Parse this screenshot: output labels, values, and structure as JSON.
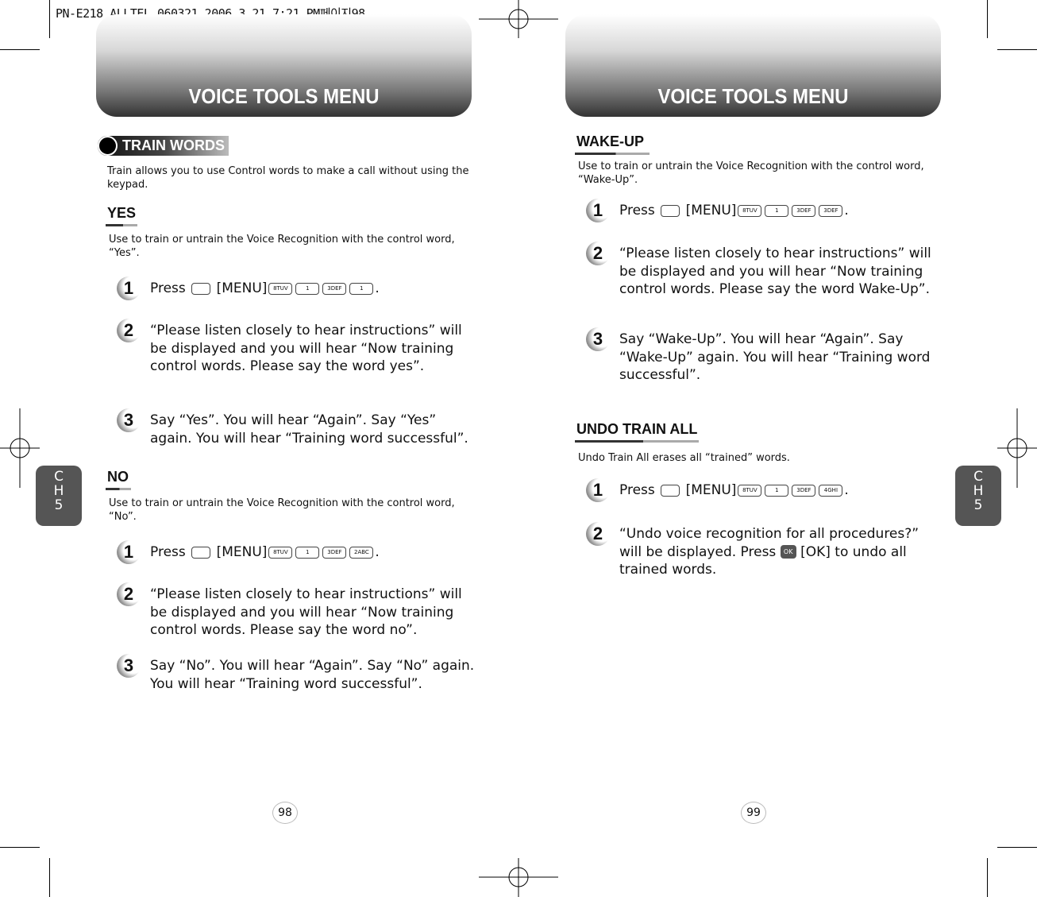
{
  "slug": "PN-E218_ALLTEL_060321  2006.3.21 7:21 PM페이지98",
  "left": {
    "banner": "VOICE TOOLS MENU",
    "section": "TRAIN WORDS",
    "intro": "Train allows you to use Control words to make a call without using the keypad.",
    "blocks": [
      {
        "title": "YES",
        "desc": "Use  to train or untrain the Voice Recognition with the control word, “Yes”.",
        "steps": [
          {
            "n": "1",
            "press": "Press",
            "menu": "[MENU]",
            "keys": [
              "8TUV",
              "1",
              "3DEF",
              "1"
            ]
          },
          {
            "n": "2",
            "text": "“Please listen closely to hear instructions” will be displayed and you will hear “Now training control words.  Please say the word yes”."
          },
          {
            "n": "3",
            "text": "Say “Yes”. You will hear “Again”. Say “Yes” again. You will hear “Training word successful”."
          }
        ]
      },
      {
        "title": "NO",
        "desc": "Use  to train or untrain the Voice Recognition with the control word, “No”.",
        "steps": [
          {
            "n": "1",
            "press": "Press",
            "menu": "[MENU]",
            "keys": [
              "8TUV",
              "1",
              "3DEF",
              "2ABC"
            ]
          },
          {
            "n": "2",
            "text": "“Please listen closely to hear instructions” will be displayed and you will hear “Now training control words.  Please say the word no”."
          },
          {
            "n": "3",
            "text": "Say “No”. You will hear “Again”. Say “No” again. You will hear “Training word successful”."
          }
        ]
      }
    ],
    "chapter": [
      "C",
      "H",
      "5"
    ],
    "page": "98"
  },
  "right": {
    "banner": "VOICE TOOLS MENU",
    "blocks": [
      {
        "title": "WAKE-UP",
        "desc": "Use  to train or untrain the Voice Recognition with the control word, “Wake-Up”.",
        "steps": [
          {
            "n": "1",
            "press": "Press",
            "menu": "[MENU]",
            "keys": [
              "8TUV",
              "1",
              "3DEF",
              "3DEF"
            ]
          },
          {
            "n": "2",
            "text": "“Please listen closely to hear instructions” will be displayed and you will hear “Now training control words.  Please say the word Wake-Up”."
          },
          {
            "n": "3",
            "text": "Say “Wake-Up”. You will hear “Again”. Say “Wake-Up” again. You will hear “Training word successful”."
          }
        ]
      },
      {
        "title": "UNDO TRAIN ALL",
        "desc": "Undo Train All erases all “trained” words.",
        "steps": [
          {
            "n": "1",
            "press": "Press",
            "menu": "[MENU]",
            "keys": [
              "8TUV",
              "1",
              "3DEF",
              "4GHI"
            ]
          },
          {
            "n": "2",
            "pre": "“Undo voice recognition for all procedures?” will be displayed. Press",
            "ok": "OK",
            "post": "[OK] to undo all trained words."
          }
        ]
      }
    ],
    "chapter": [
      "C",
      "H",
      "5"
    ],
    "page": "99"
  }
}
